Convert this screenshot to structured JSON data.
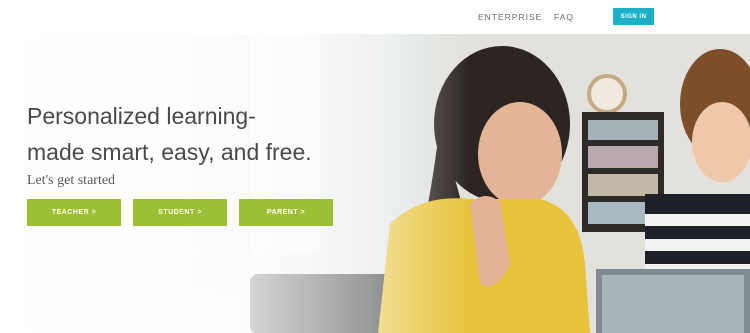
{
  "header": {
    "nav": [
      "ENTERPRISE",
      "FAQ"
    ],
    "sign_in_label": "SIGN IN"
  },
  "hero": {
    "headline_line1": "Personalized learning-",
    "headline_line2": "made smart, easy, and free.",
    "subheadline": "Let's get started",
    "buttons": [
      "TEACHER >",
      "STUDENT >",
      "PARENT >"
    ]
  },
  "colors": {
    "accent_green": "#9dbf36",
    "accent_teal": "#1cb0c9",
    "text_dark": "#4a4a4a"
  }
}
